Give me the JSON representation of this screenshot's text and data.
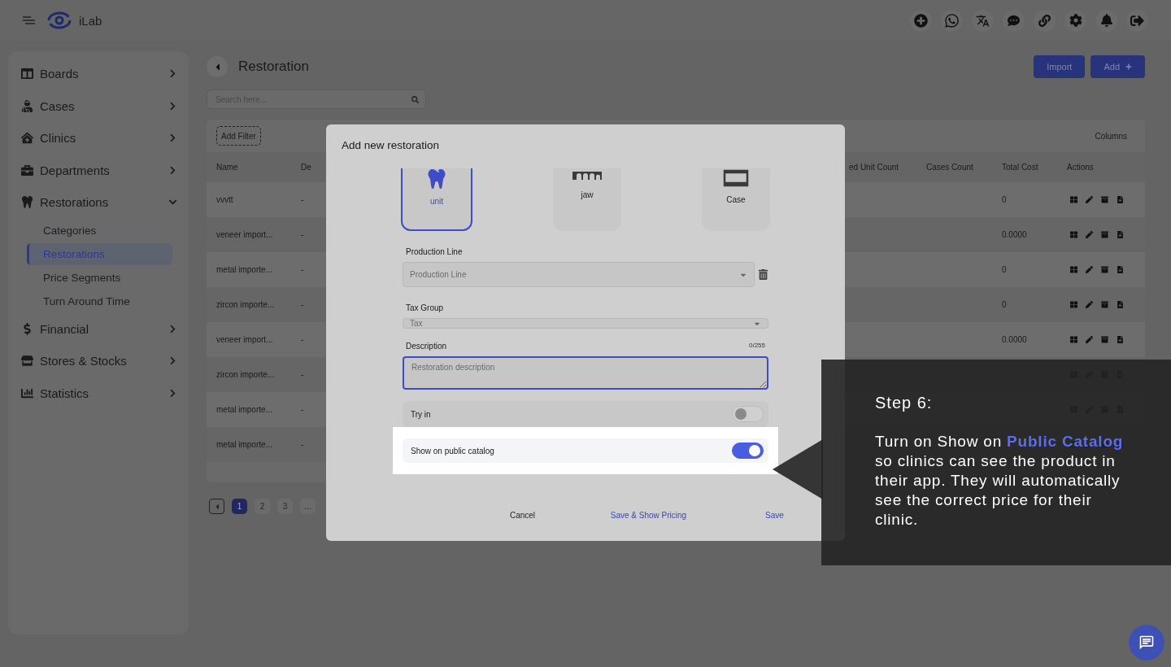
{
  "app": {
    "name": "iLab"
  },
  "sidebar": {
    "items": [
      {
        "label": "Boards",
        "expanded": false
      },
      {
        "label": "Cases",
        "expanded": false
      },
      {
        "label": "Clinics",
        "expanded": false
      },
      {
        "label": "Departments",
        "expanded": false
      },
      {
        "label": "Restorations",
        "expanded": true,
        "children": [
          {
            "label": "Categories",
            "selected": false
          },
          {
            "label": "Restorations",
            "selected": true
          },
          {
            "label": "Price Segments",
            "selected": false
          },
          {
            "label": "Turn Around Time",
            "selected": false
          }
        ]
      },
      {
        "label": "Financial",
        "expanded": false
      },
      {
        "label": "Stores & Stocks",
        "expanded": false
      },
      {
        "label": "Statistics",
        "expanded": false
      }
    ]
  },
  "page": {
    "title": "Restoration",
    "buttons": [
      "Import",
      "Add"
    ],
    "search": {
      "placeholder": "Search here..."
    }
  },
  "table": {
    "filter_button": "Add Filter",
    "columns_button": "Columns",
    "columns": [
      "Name",
      "De",
      "ed Unit Count",
      "Cases Count",
      "Total Cost",
      "Actions"
    ],
    "rows": [
      {
        "name": "vvvtt",
        "col_2": "-",
        "total_cost": "0"
      },
      {
        "name": "veneer import...",
        "col_2": "-",
        "total_cost": "0.0000"
      },
      {
        "name": "metal importe...",
        "col_2": "-",
        "total_cost": "0"
      },
      {
        "name": "zircon importe...",
        "col_2": "-",
        "total_cost": "0"
      },
      {
        "name": "veneer import...",
        "col_2": "-",
        "total_cost": "0.0000"
      },
      {
        "name": "zircon importe...",
        "col_2": "-"
      },
      {
        "name": "metal importe...",
        "col_2": "-"
      },
      {
        "name": "metal importe...",
        "col_2": "-"
      }
    ]
  },
  "pagination": {
    "pages": [
      {
        "label": "1",
        "selected": true
      },
      {
        "label": "2",
        "selected": false
      },
      {
        "label": "3",
        "selected": false
      },
      {
        "label": "...",
        "selected": false
      }
    ]
  },
  "modal": {
    "title": "Add new restoration",
    "types": [
      {
        "label": "unit",
        "kind": "tooth",
        "selected": true
      },
      {
        "label": "jaw",
        "kind": "jaw",
        "selected": false
      },
      {
        "label": "Case",
        "kind": "case",
        "selected": false
      }
    ],
    "production_line": {
      "label": "Production Line",
      "placeholder": "Production Line"
    },
    "tax_group": {
      "label": "Tax Group",
      "placeholder": "Tax"
    },
    "description": {
      "label": "Description",
      "counter": "0/255",
      "placeholder": "Restoration description"
    },
    "try_in": {
      "label": "Try in",
      "on": false
    },
    "public_catalog": {
      "label": "Show on public catalog",
      "on": true
    },
    "buttons": {
      "cancel": "Cancel",
      "save_pricing": "Save & Show Pricing",
      "save": "Save"
    }
  },
  "tooltip": {
    "title": "Step 6:",
    "text": "Turn on Show on **Public Catalog** so clinics can see the product in their app. They will automatically see the correct price for their clinic."
  }
}
